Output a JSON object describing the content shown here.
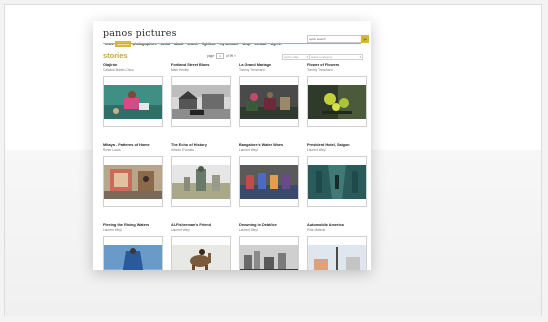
{
  "site": {
    "logo": "panos pictures",
    "search_placeholder": "quick search",
    "search_button": "go"
  },
  "nav": [
    {
      "label": "news",
      "active": false
    },
    {
      "label": "stories",
      "active": true
    },
    {
      "label": "photographers",
      "active": false
    },
    {
      "label": "social",
      "active": false
    },
    {
      "label": "about",
      "active": false
    },
    {
      "label": "search",
      "active": false
    },
    {
      "label": "lightbox",
      "active": false
    },
    {
      "label": "my account",
      "active": false
    },
    {
      "label": "shop",
      "active": false
    },
    {
      "label": "contact",
      "active": false
    },
    {
      "label": "sign in",
      "active": false
    }
  ],
  "page_title": "stories",
  "pager": {
    "prefix": "page",
    "current": "1",
    "suffix": "of 99 »"
  },
  "filters": [
    {
      "label": "sort by date"
    },
    {
      "label": "select a category"
    }
  ],
  "accent_color": "#d4b93a",
  "stories": [
    {
      "title": "Olajirón",
      "author": "Catalina Martin-Chico",
      "icon": "photo-children-pool"
    },
    {
      "title": "Fortland Street Blues",
      "author": "Mark Henley",
      "icon": "photo-street-houses"
    },
    {
      "title": "La Grand Mariage",
      "author": "Tommy Trenchard",
      "icon": "photo-wedding-crowd"
    },
    {
      "title": "Flower of Flowers",
      "author": "Tommy Trenchard",
      "icon": "photo-flowers"
    },
    {
      "title": "Mitaya - Patterns of Home",
      "author": "Rosie Lucas",
      "icon": "photo-painted-wall"
    },
    {
      "title": "The Echo of History",
      "author": "Alfredo D'Amato",
      "icon": "photo-monument"
    },
    {
      "title": "Bangalore's Water Woes",
      "author": "Laurent Weyl",
      "icon": "photo-water-queue"
    },
    {
      "title": "President Hotel, Saigon",
      "author": "Laurent Weyl",
      "icon": "photo-hotel-corridor"
    },
    {
      "title": "Fleeing the Rising Waters",
      "author": "Laurent Weyl",
      "icon": "photo-blue-sky-figure"
    },
    {
      "title": "Al-Fisherman's Friend",
      "author": "Laurent Weyl",
      "icon": "photo-camel"
    },
    {
      "title": "Drowning in Debt/ice",
      "author": "Laurent Weyl",
      "icon": "photo-city-skyline"
    },
    {
      "title": "Automobile America",
      "author": "Piotr Malecki",
      "icon": "photo-palm-street"
    }
  ]
}
